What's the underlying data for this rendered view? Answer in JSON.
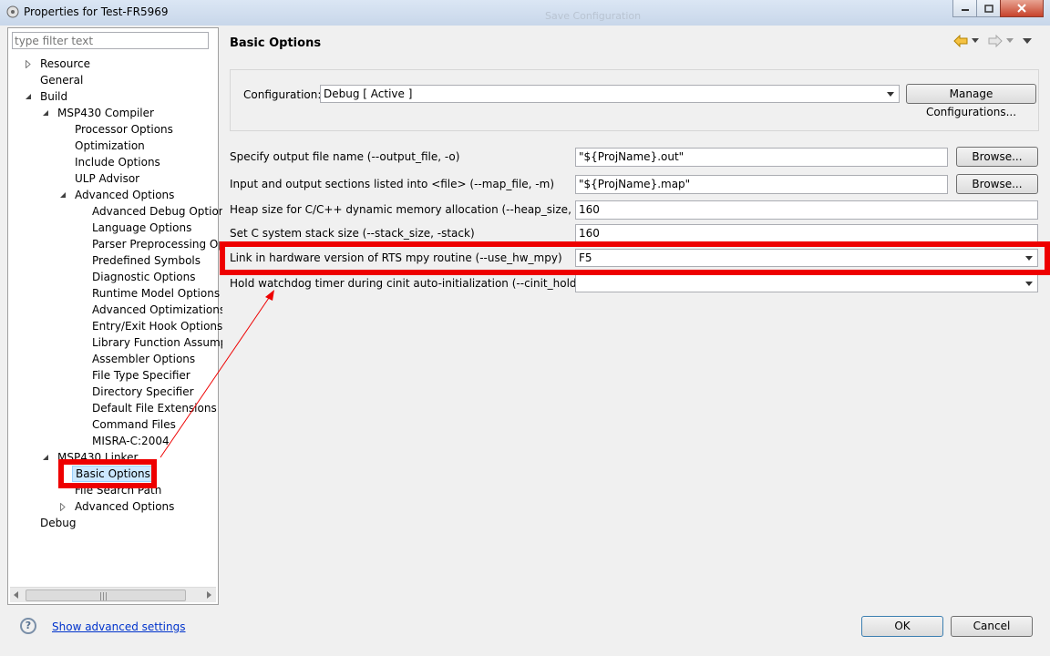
{
  "window": {
    "title": "Properties for Test-FR5969",
    "background_ghost_text": "Save Configuration"
  },
  "filter": {
    "placeholder": "type filter text"
  },
  "tree": [
    {
      "label": "Resource",
      "twisty": "collapsed"
    },
    {
      "label": "General",
      "twisty": "none"
    },
    {
      "label": "Build",
      "twisty": "expanded"
    },
    {
      "label": "MSP430 Compiler",
      "twisty": "expanded"
    },
    {
      "label": "Processor Options",
      "twisty": "none"
    },
    {
      "label": "Optimization",
      "twisty": "none"
    },
    {
      "label": "Include Options",
      "twisty": "none"
    },
    {
      "label": "ULP Advisor",
      "twisty": "none"
    },
    {
      "label": "Advanced Options",
      "twisty": "expanded"
    },
    {
      "label": "Advanced Debug Options",
      "twisty": "none"
    },
    {
      "label": "Language Options",
      "twisty": "none"
    },
    {
      "label": "Parser Preprocessing Opti",
      "twisty": "none"
    },
    {
      "label": "Predefined Symbols",
      "twisty": "none"
    },
    {
      "label": "Diagnostic Options",
      "twisty": "none"
    },
    {
      "label": "Runtime Model Options",
      "twisty": "none"
    },
    {
      "label": "Advanced Optimizations",
      "twisty": "none"
    },
    {
      "label": "Entry/Exit Hook Options",
      "twisty": "none"
    },
    {
      "label": "Library Function Assumpt",
      "twisty": "none"
    },
    {
      "label": "Assembler Options",
      "twisty": "none"
    },
    {
      "label": "File Type Specifier",
      "twisty": "none"
    },
    {
      "label": "Directory Specifier",
      "twisty": "none"
    },
    {
      "label": "Default File Extensions",
      "twisty": "none"
    },
    {
      "label": "Command Files",
      "twisty": "none"
    },
    {
      "label": "MISRA-C:2004",
      "twisty": "none"
    },
    {
      "label": "MSP430 Linker",
      "twisty": "expanded"
    },
    {
      "label": "Basic Options",
      "twisty": "none",
      "selected": true
    },
    {
      "label": "File Search Path",
      "twisty": "none"
    },
    {
      "label": "Advanced Options",
      "twisty": "collapsed"
    },
    {
      "label": "Debug",
      "twisty": "none"
    }
  ],
  "page": {
    "title": "Basic Options"
  },
  "configuration": {
    "label": "Configuration:",
    "value": "Debug  [ Active ]",
    "manage_button": "Manage Configurations..."
  },
  "options": {
    "output_file": {
      "label": "Specify output file name (--output_file, -o)",
      "value": "\"${ProjName}.out\"",
      "button": "Browse..."
    },
    "map_file": {
      "label": "Input and output sections listed into <file> (--map_file, -m)",
      "value": "\"${ProjName}.map\"",
      "button": "Browse..."
    },
    "heap_size": {
      "label": "Heap size for C/C++ dynamic memory allocation (--heap_size, -heap)",
      "value": "160"
    },
    "stack_size": {
      "label": "Set C system stack size (--stack_size, -stack)",
      "value": "160"
    },
    "use_hw_mpy": {
      "label": "Link in hardware version of RTS mpy routine (--use_hw_mpy)",
      "value": "F5"
    },
    "cinit_hold_wdt": {
      "label": "Hold watchdog timer during cinit auto-initialization (--cinit_hold_wdt)",
      "value": ""
    }
  },
  "footer": {
    "show_advanced": "Show advanced settings",
    "ok": "OK",
    "cancel": "Cancel"
  },
  "colors": {
    "annotation_red": "#ee0000",
    "link_blue": "#0033cc",
    "selection": "#cce8ff"
  }
}
